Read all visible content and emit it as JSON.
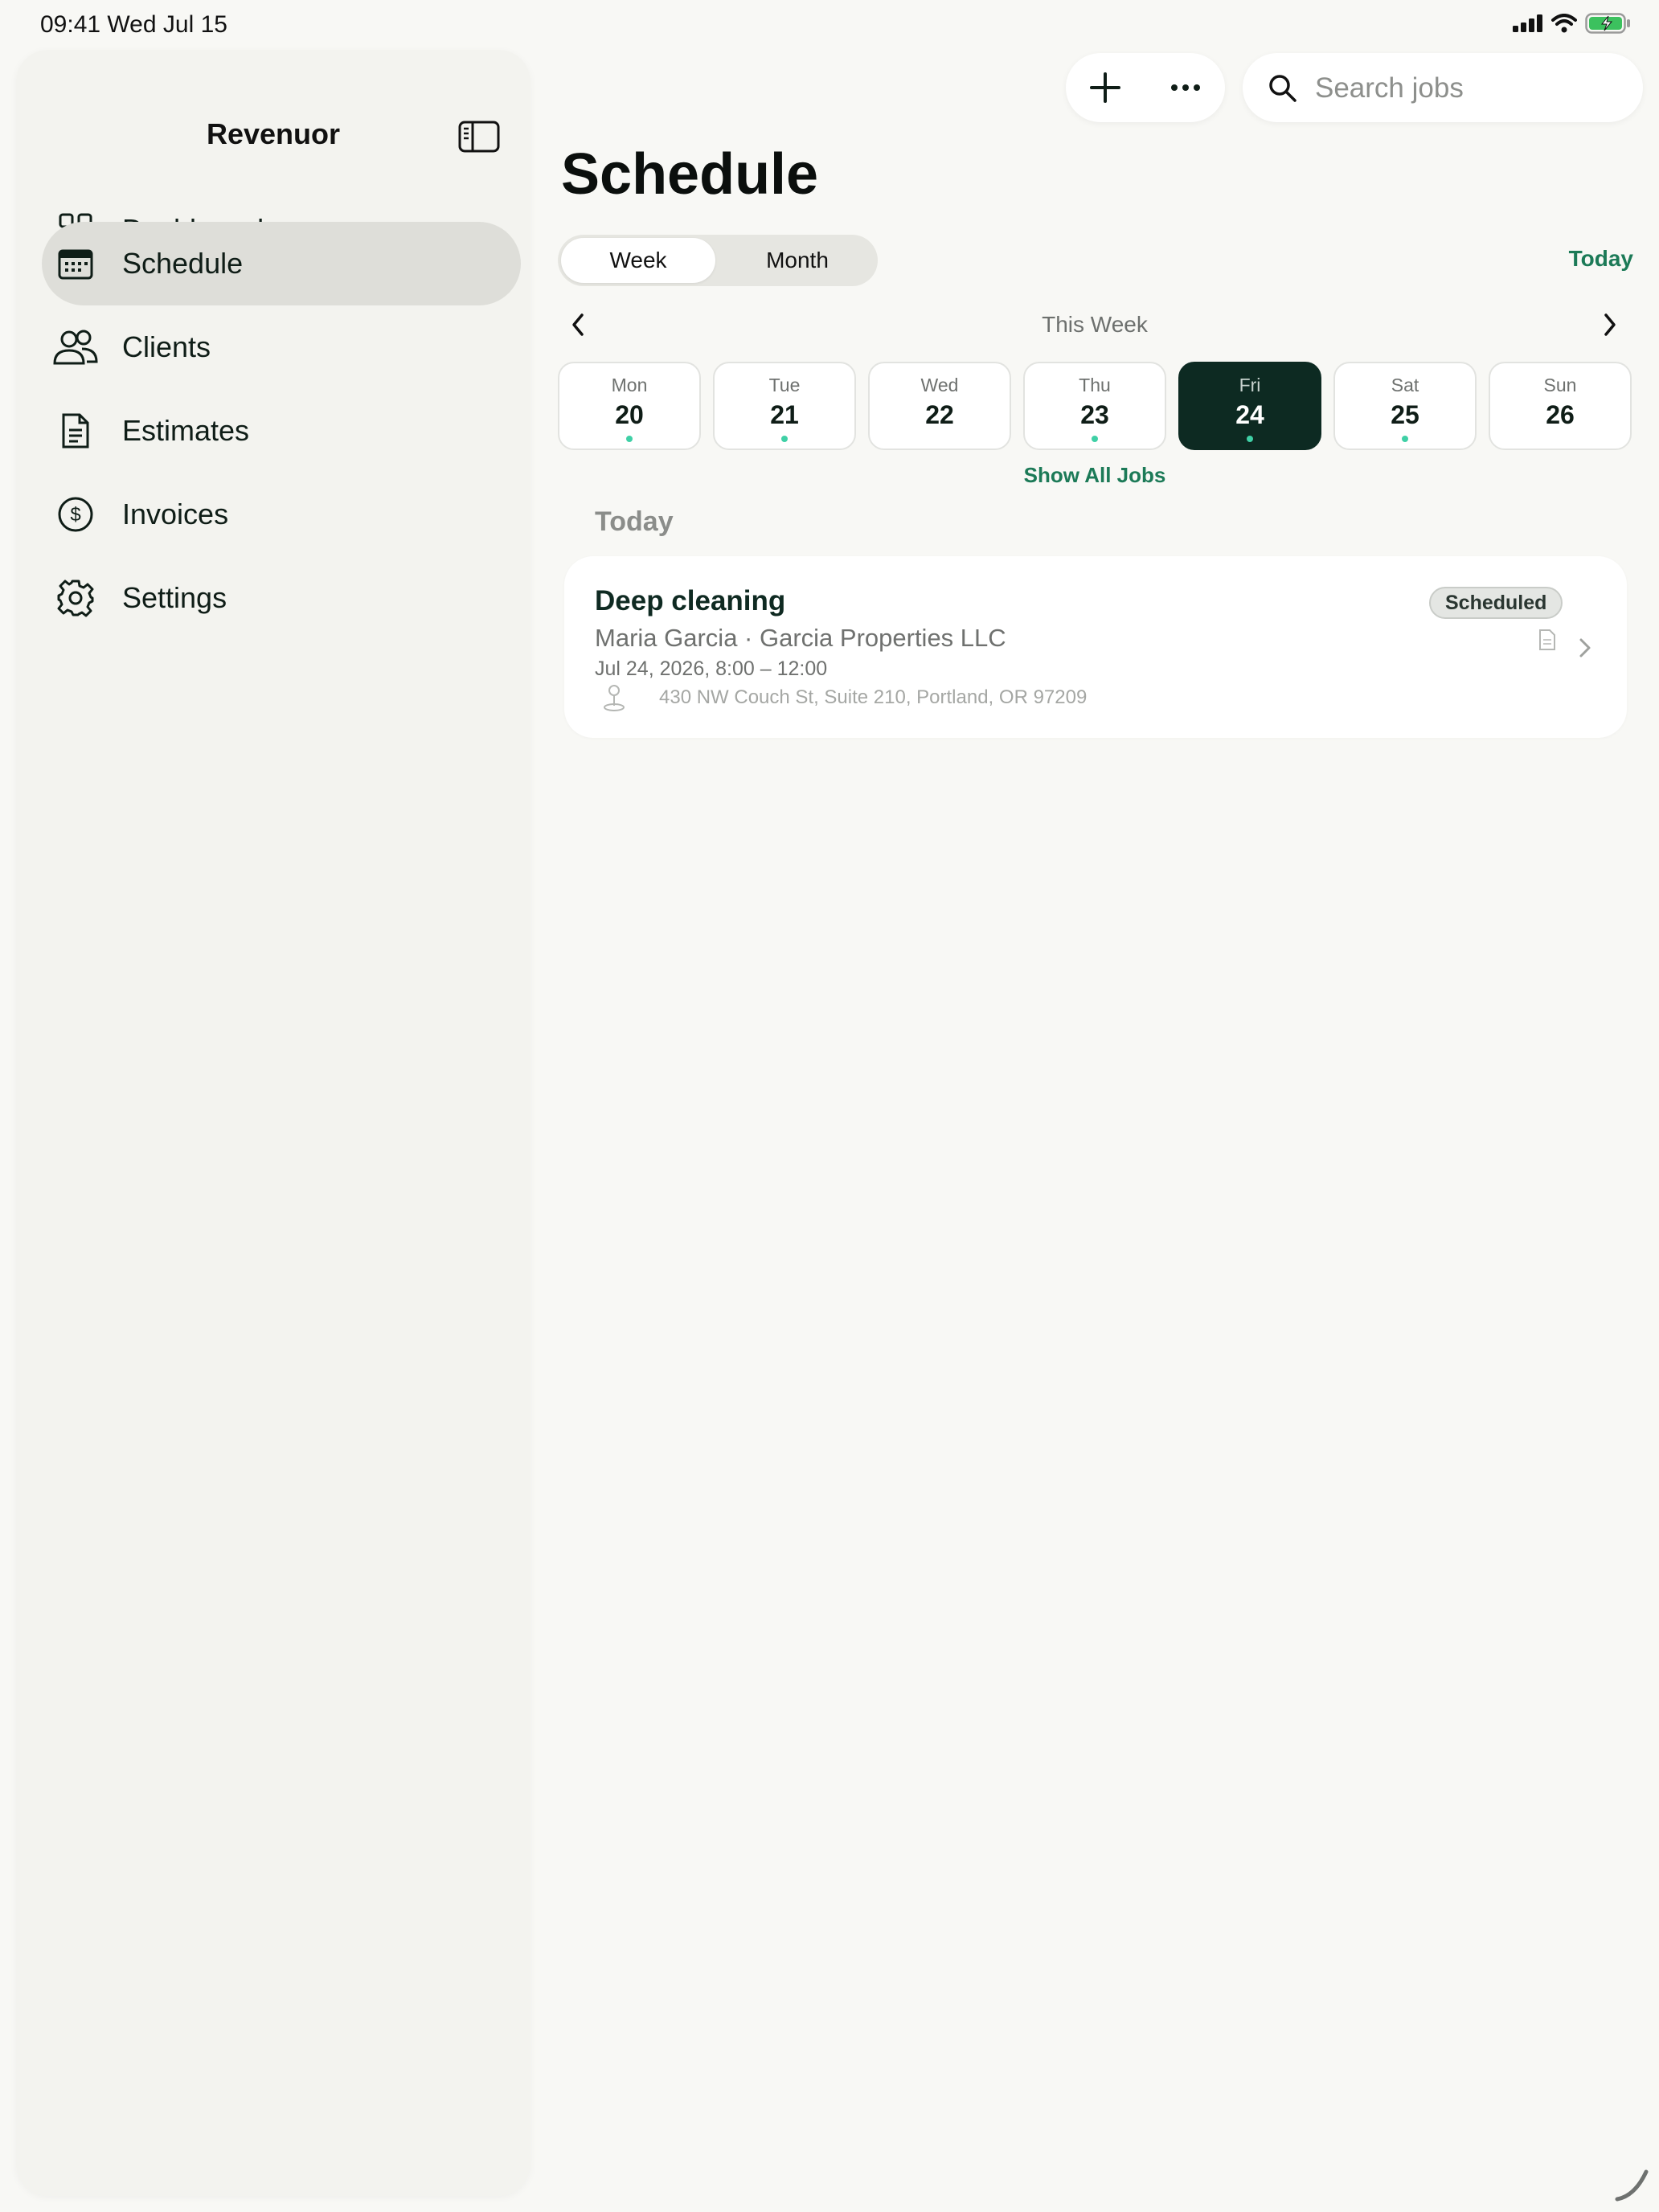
{
  "status_bar": {
    "time_date": "09:41  Wed Jul 15"
  },
  "sidebar": {
    "app_title": "Revenuor",
    "items": [
      {
        "label": "Dashboard",
        "icon": "grid-icon",
        "active": false
      },
      {
        "label": "Schedule",
        "icon": "calendar-icon",
        "active": true
      },
      {
        "label": "Clients",
        "icon": "people-icon",
        "active": false
      },
      {
        "label": "Estimates",
        "icon": "document-icon",
        "active": false
      },
      {
        "label": "Invoices",
        "icon": "dollar-circle-icon",
        "active": false
      },
      {
        "label": "Settings",
        "icon": "gear-icon",
        "active": false
      }
    ]
  },
  "toolbar": {
    "search_placeholder": "Search jobs"
  },
  "main": {
    "title": "Schedule",
    "view_toggle": {
      "week_label": "Week",
      "month_label": "Month",
      "selected": "Week"
    },
    "today_label": "Today",
    "week_label": "This Week",
    "days": [
      {
        "name": "Mon",
        "num": "20",
        "has_jobs": true,
        "selected": false
      },
      {
        "name": "Tue",
        "num": "21",
        "has_jobs": true,
        "selected": false
      },
      {
        "name": "Wed",
        "num": "22",
        "has_jobs": false,
        "selected": false
      },
      {
        "name": "Thu",
        "num": "23",
        "has_jobs": true,
        "selected": false
      },
      {
        "name": "Fri",
        "num": "24",
        "has_jobs": true,
        "selected": true
      },
      {
        "name": "Sat",
        "num": "25",
        "has_jobs": true,
        "selected": false
      },
      {
        "name": "Sun",
        "num": "26",
        "has_jobs": false,
        "selected": false
      }
    ],
    "show_all_label": "Show All Jobs",
    "section_title": "Today",
    "job": {
      "title": "Deep cleaning",
      "client": "Maria Garcia · Garcia Properties LLC",
      "time": "Jul 24, 2026, 8:00 – 12:00",
      "address": "430 NW Couch St, Suite 210, Portland, OR 97209",
      "status": "Scheduled"
    }
  },
  "colors": {
    "accent": "#1c7a57",
    "selected_day_bg": "#0d2a22",
    "job_dot": "#3fd0a6",
    "background": "#f8f8f5",
    "sidebar_bg": "#f3f3ef",
    "active_nav_bg": "#deded9"
  }
}
